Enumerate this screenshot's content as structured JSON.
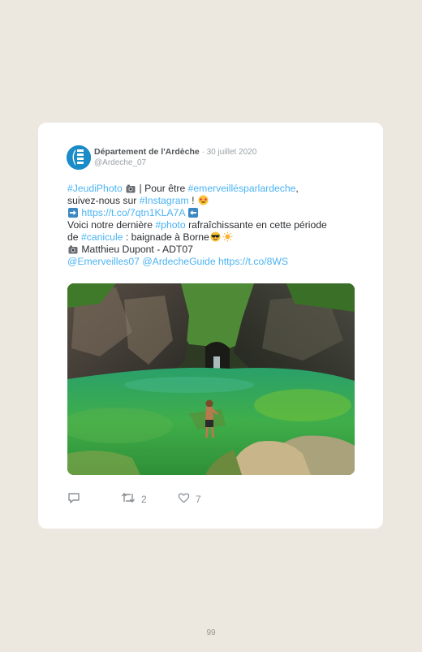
{
  "tweet": {
    "author_name": "Département de l'Ardèche",
    "separator": " · ",
    "date": "30 juillet 2020",
    "handle": "@Ardeche_07",
    "line1": {
      "hashtag_jeudi": "#JeudiPhoto",
      "text_pour_etre": " | Pour être ",
      "hashtag_emerveilles": "#emerveillésparlardeche",
      "comma": ","
    },
    "line2": {
      "text_suivez": "suivez-nous sur ",
      "hashtag_instagram": "#Instagram",
      "exclaim": " !"
    },
    "line3": {
      "link": "https://t.co/7qtn1KLA7A"
    },
    "line4": {
      "text_voici": "Voici notre dernière ",
      "hashtag_photo": "#photo",
      "text_rafraichissante": " rafraîchissante en cette période"
    },
    "line5": {
      "text_de": "de ",
      "hashtag_canicule": "#canicule",
      "text_baignade": " : baignade à Borne"
    },
    "line6": {
      "credit": " Matthieu Dupont - ADT07"
    },
    "line7": {
      "mention_emerveilles": "@Emerveilles07",
      "mention_guide": "@ArdecheGuide",
      "link_short": "https://t.co/8WS"
    },
    "photo_alt": "Baignade à Borne"
  },
  "actions": {
    "reply_icon": "reply-icon",
    "retweet_icon": "retweet-icon",
    "retweet_count": "2",
    "like_icon": "heart-icon",
    "like_count": "7"
  },
  "footer": {
    "page_number": "99"
  },
  "colors": {
    "link": "#4ab3f4",
    "background": "#ece7df",
    "card": "#ffffff",
    "avatar": "#1a8cc8"
  }
}
